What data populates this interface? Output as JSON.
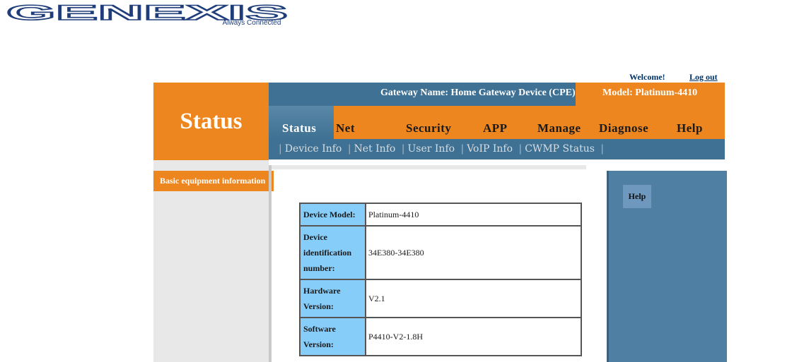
{
  "logo": {
    "text": "GENEXIS",
    "tagline": "Always Connected"
  },
  "header": {
    "welcome": "Welcome!",
    "logout": "Log out",
    "section_title": "Status",
    "gateway_name": "Gateway Name: Home Gateway Device (CPE)",
    "model": "Model: Platinum-4410"
  },
  "nav": {
    "items": [
      {
        "label": "Status"
      },
      {
        "label": "Net"
      },
      {
        "label": "Security"
      },
      {
        "label": "APP"
      },
      {
        "label": "Manage"
      },
      {
        "label": "Diagnose"
      },
      {
        "label": "Help"
      }
    ]
  },
  "subnav": {
    "items": [
      {
        "label": "Device Info"
      },
      {
        "label": "Net Info"
      },
      {
        "label": "User Info"
      },
      {
        "label": "VoIP Info"
      },
      {
        "label": "CWMP Status"
      }
    ]
  },
  "sidebar": {
    "item": "Basic equipment information"
  },
  "help": {
    "button": "Help"
  },
  "table": {
    "rows": [
      {
        "label": "Device Model:",
        "value": "Platinum-4410"
      },
      {
        "label": "Device identification number:",
        "value": "34E380-34E380"
      },
      {
        "label": "Hardware Version:",
        "value": "V2.1"
      },
      {
        "label": "Software Version:",
        "value": "P4410-V2-1.8H"
      }
    ]
  },
  "colors": {
    "orange": "#ee861f",
    "blue_bar": "#3e7193",
    "help_panel": "#4f7fa3",
    "table_label": "#87cdfa"
  }
}
